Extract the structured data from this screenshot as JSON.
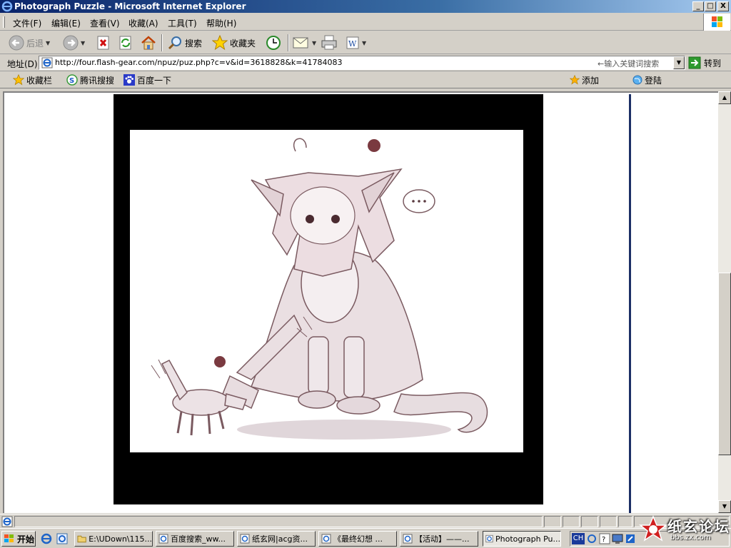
{
  "window": {
    "title": "Photograph Puzzle - Microsoft Internet Explorer",
    "controls": {
      "minimize": "_",
      "maximize": "□",
      "close": "X"
    }
  },
  "menu": {
    "items": [
      "文件(F)",
      "编辑(E)",
      "查看(V)",
      "收藏(A)",
      "工具(T)",
      "帮助(H)"
    ]
  },
  "toolbar": {
    "back_label": "后退",
    "search_label": "搜索",
    "favorites_label": "收藏夹"
  },
  "address": {
    "label": "地址(D)",
    "url": "http://four.flash-gear.com/npuz/puz.php?c=v&id=3618828&k=41784083",
    "search_hint": "←输入关键词搜索",
    "go_label": "转到"
  },
  "links": {
    "favbar_label": "收藏栏",
    "tencent_label": "腾讯搜搜",
    "baidu_label": "百度一下",
    "add_label": "添加",
    "login_label": "登陆"
  },
  "taskbar": {
    "start_label": "开始",
    "tasks": [
      {
        "label": "E:\\UDown\\115...",
        "active": false
      },
      {
        "label": "百度搜索_ww...",
        "active": false
      },
      {
        "label": "纸玄网|acg资...",
        "active": false
      },
      {
        "label": "《最终幻想 ...",
        "active": false
      },
      {
        "label": "【活动】——...",
        "active": false
      },
      {
        "label": "Photograph Pu...",
        "active": true
      }
    ],
    "tray_lang": "CH"
  },
  "watermark": {
    "text": "纸玄论坛",
    "sub": "bbs.zx.com"
  },
  "colors": {
    "titlebar": "#0a246a",
    "taskbar": "#d4d0c8",
    "content_bg": "#ffffff"
  },
  "icons": [
    "ie-icon",
    "back-arrow-icon",
    "forward-arrow-icon",
    "stop-icon",
    "refresh-icon",
    "home-icon",
    "search-icon",
    "favorites-star-icon",
    "history-icon",
    "mail-icon",
    "print-icon",
    "edit-icon",
    "go-arrow-icon",
    "windows-logo-icon"
  ]
}
